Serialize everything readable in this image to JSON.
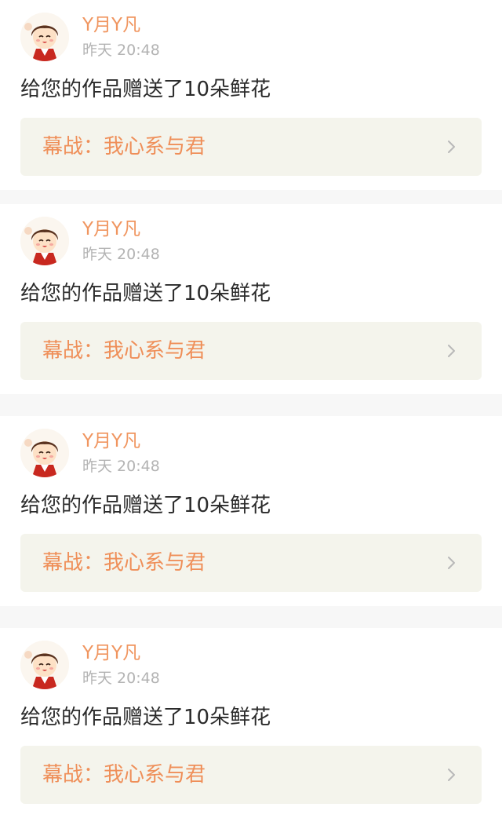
{
  "notifications": [
    {
      "username": "Y月Y凡",
      "time": "昨天 20:48",
      "message": "给您的作品赠送了10朵鲜花",
      "work_title": "幕战：我心系与君"
    },
    {
      "username": "Y月Y凡",
      "time": "昨天 20:48",
      "message": "给您的作品赠送了10朵鲜花",
      "work_title": "幕战：我心系与君"
    },
    {
      "username": "Y月Y凡",
      "time": "昨天 20:48",
      "message": "给您的作品赠送了10朵鲜花",
      "work_title": "幕战：我心系与君"
    },
    {
      "username": "Y月Y凡",
      "time": "昨天 20:48",
      "message": "给您的作品赠送了10朵鲜花",
      "work_title": "幕战：我心系与君"
    }
  ],
  "icons": {
    "avatar": "cartoon-boy-avatar-icon",
    "chevron": "chevron-right-icon"
  },
  "colors": {
    "username": "#f0955f",
    "work_title": "#ef8f59",
    "timestamp": "#b3b3b3",
    "card_bg": "#ffffff",
    "link_bg": "#f4f4ec",
    "separator": "#f7f7f7"
  }
}
